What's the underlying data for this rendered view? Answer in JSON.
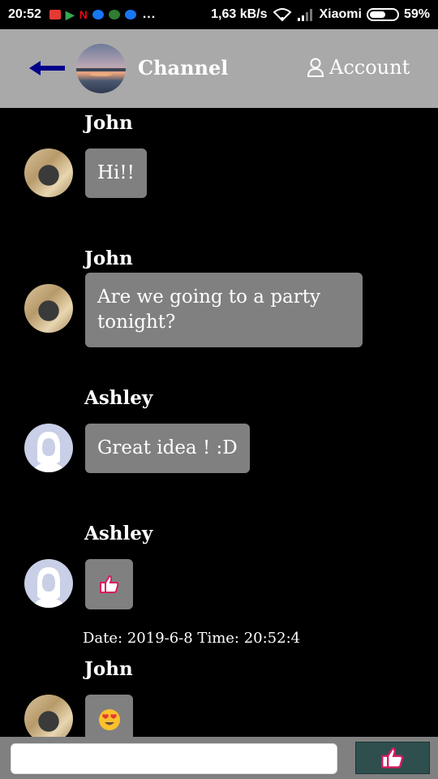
{
  "status_bar": {
    "time": "20:52",
    "more": "...",
    "speed": "1,63 kB/s",
    "carrier": "Xiaomi",
    "battery": "59%",
    "battery_level": 0.59
  },
  "header": {
    "title": "Channel",
    "account_label": "Account"
  },
  "messages": [
    {
      "sender": "John",
      "text": "Hi!!"
    },
    {
      "sender": "John",
      "text": "Are we going to a party tonight?"
    },
    {
      "sender": "Ashley",
      "text": "Great idea ! :D"
    },
    {
      "sender": "Ashley",
      "icon": "thumbs-up-icon"
    },
    {
      "sender": "John",
      "icon": "heart-eyes-emoji-icon"
    }
  ],
  "date_separator": "Date: 2019-6-8 Time: 20:52:4",
  "input": {
    "placeholder": "",
    "value": ""
  },
  "colors": {
    "header_bg": "#a9a9a9",
    "bubble_bg": "#808080",
    "accent_arrow": "#00008b",
    "like_button_bg": "#2f4f4f"
  }
}
